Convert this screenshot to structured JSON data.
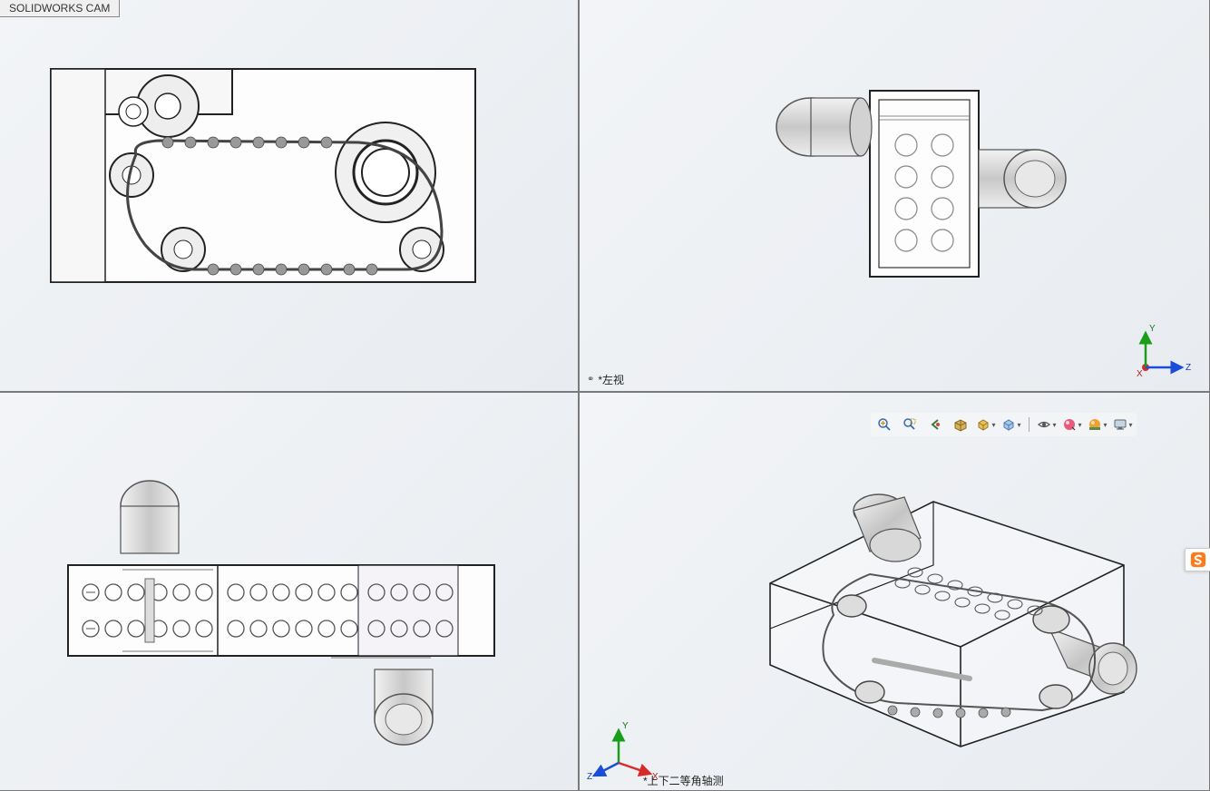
{
  "tab": {
    "label": "SOLIDWORKS CAM"
  },
  "views": {
    "top_left": {
      "name": "front-view"
    },
    "top_right": {
      "name": "left-view",
      "label": "*左视"
    },
    "bottom_left": {
      "name": "top-view"
    },
    "bottom_right": {
      "name": "isometric-view",
      "label": "*上下二等角轴测"
    }
  },
  "triad": {
    "x_label": "X",
    "y_label": "Y",
    "z_label": "Z"
  },
  "toolbar": {
    "zoom_fit": "Zoom to Fit",
    "zoom_area": "Zoom to Area",
    "prev_view": "Previous View",
    "section_view": "Section View",
    "view_orient": "View Orientation",
    "display_style": "Display Style",
    "hide_show": "Hide/Show Items",
    "edit_appearance": "Edit Appearance",
    "apply_scene": "Apply Scene",
    "view_settings": "View Settings"
  },
  "ime": {
    "name": "Sogou IME"
  }
}
